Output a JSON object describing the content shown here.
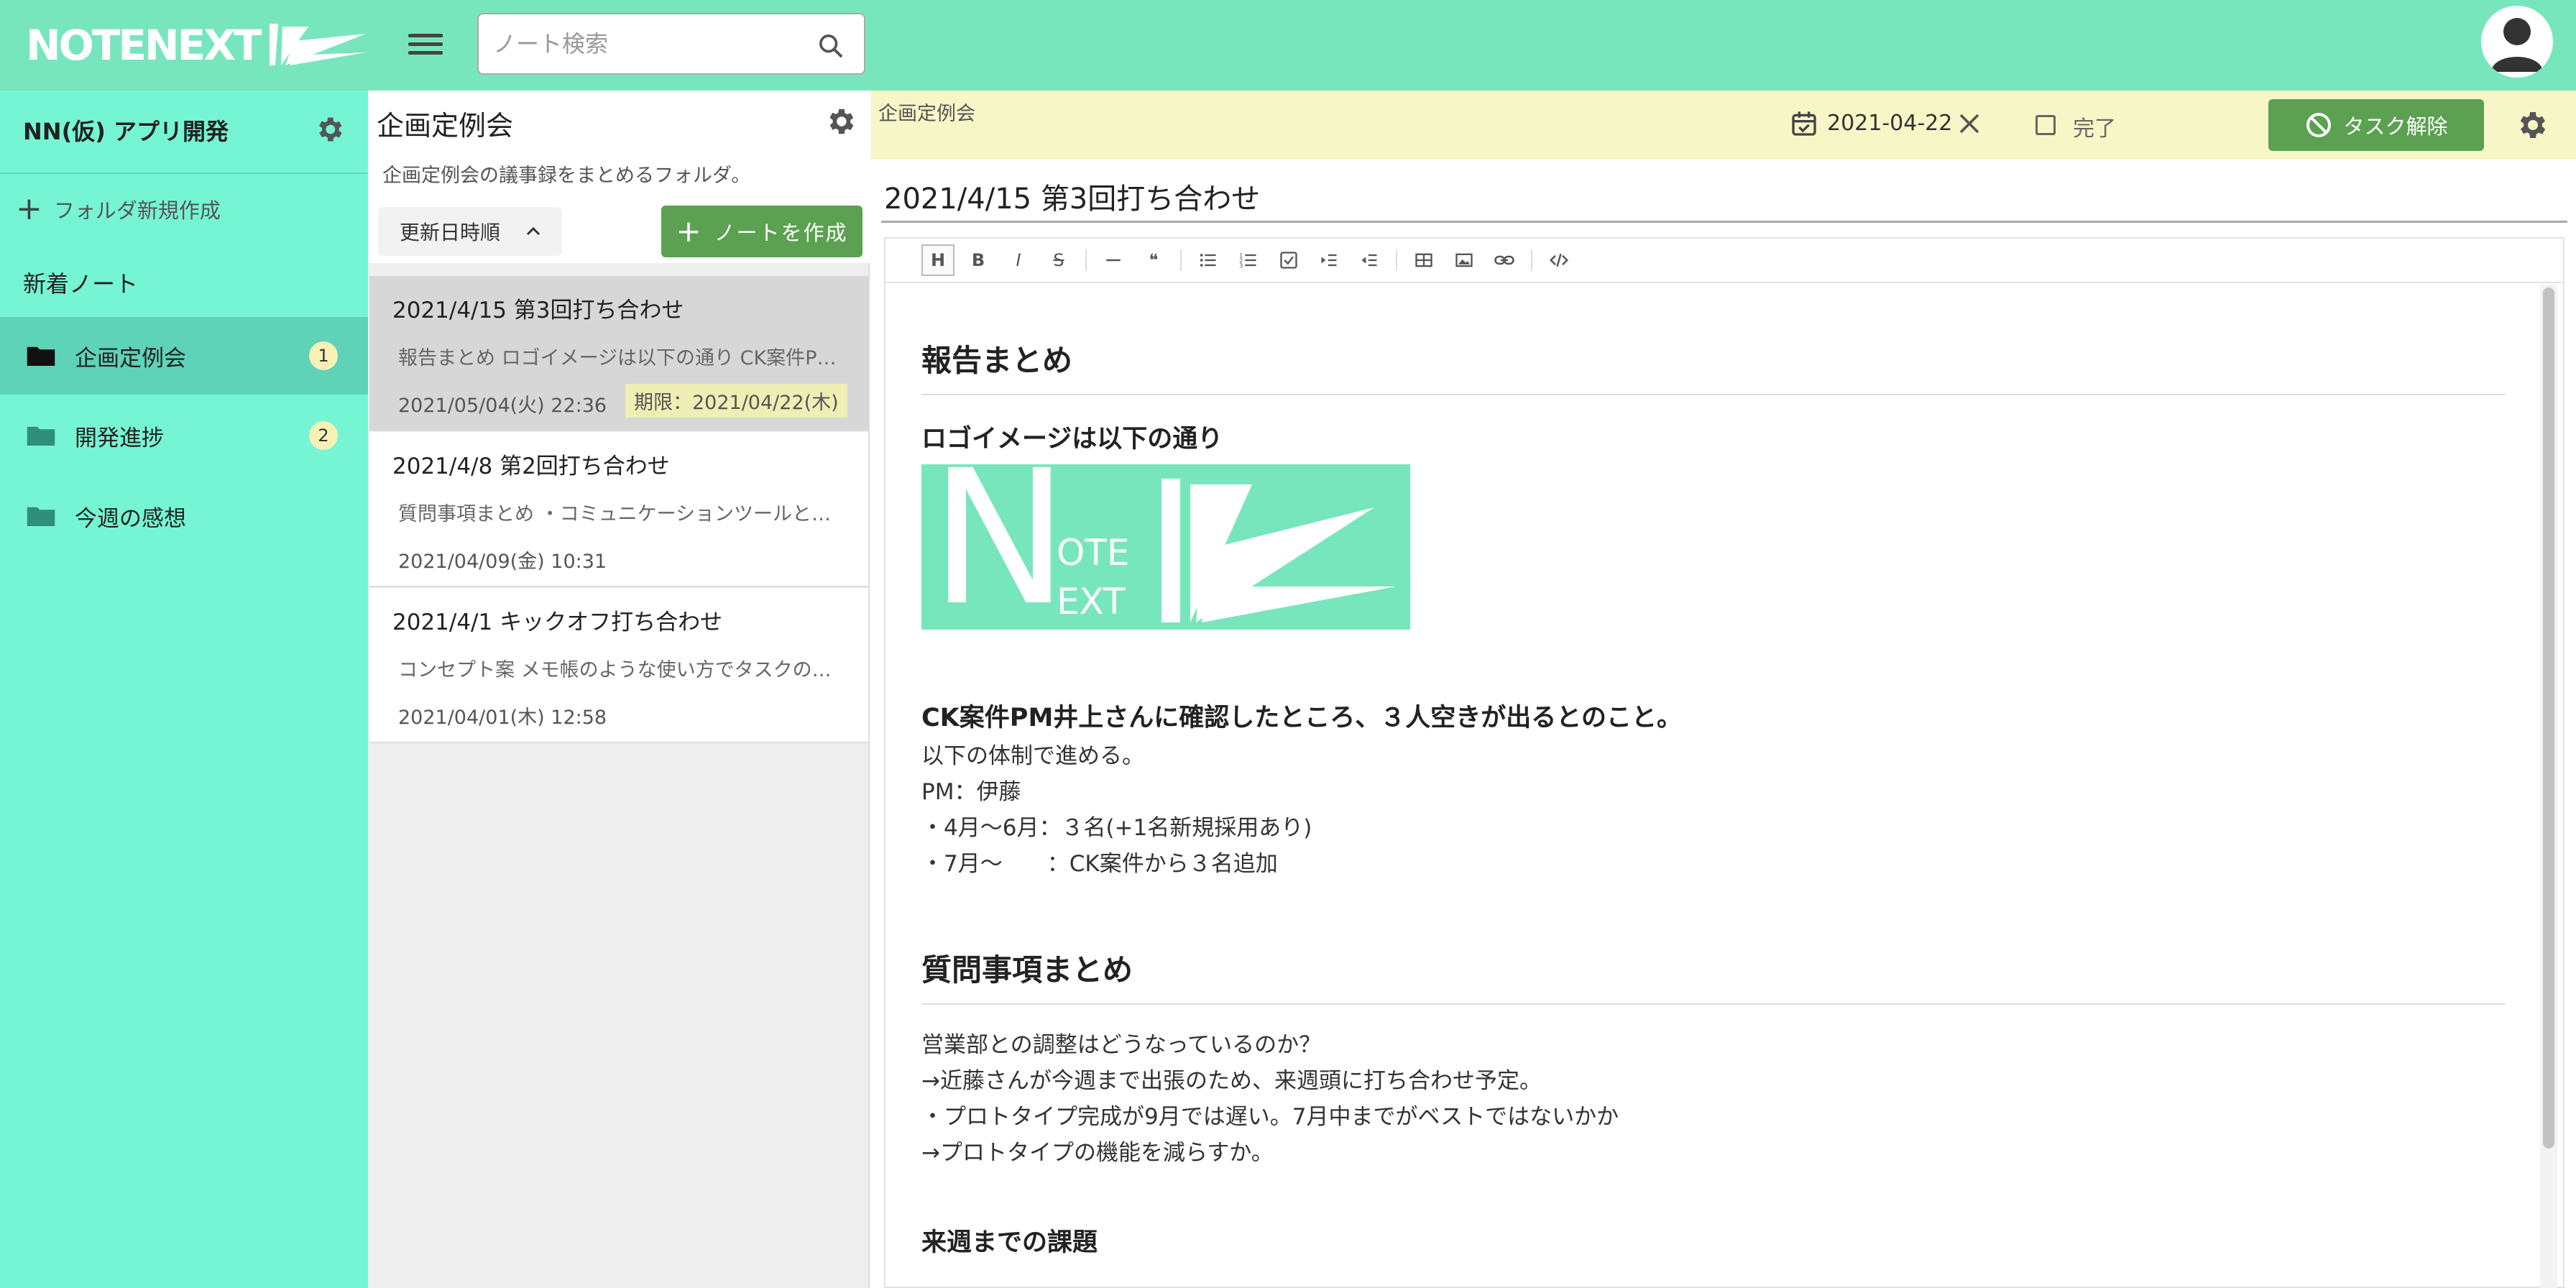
{
  "app": {
    "logo_text": "NOTENEXT",
    "accent": "#78e6bc",
    "sidebar_bg": "#76f5d4",
    "primary_button": "#5ba151"
  },
  "topbar": {
    "search_placeholder": "ノート検索",
    "icons": [
      "menu-icon",
      "search-icon",
      "avatar-icon"
    ]
  },
  "sidebar": {
    "project_title": "NN(仮) アプリ開発",
    "new_folder_label": "フォルダ新規作成",
    "new_notes_label": "新着ノート",
    "folders": [
      {
        "label": "企画定例会",
        "count": "1",
        "active": true
      },
      {
        "label": "開発進捗",
        "count": "2",
        "active": false
      },
      {
        "label": "今週の感想",
        "count": "",
        "active": false
      }
    ]
  },
  "notes_panel": {
    "folder_title": "企画定例会",
    "folder_description": "企画定例会の議事録をまとめるフォルダ。",
    "sort_label": "更新日時順",
    "create_label": "ノートを作成",
    "notes": [
      {
        "title": "2021/4/15 第3回打ち合わせ",
        "preview": "報告まとめ ロゴイメージは以下の通り CK案件PM井上さんに確認したところ",
        "date": "2021/05/04(火) 22:36",
        "deadline": "期限：2021/04/22(木)",
        "active": true
      },
      {
        "title": "2021/4/8 第2回打ち合わせ",
        "preview": "質問事項まとめ ・コミュニケーションツールとしての位置付け",
        "date": "2021/04/09(金) 10:31",
        "deadline": "",
        "active": false
      },
      {
        "title": "2021/4/1 キックオフ打ち合わせ",
        "preview": "コンセプト案 メモ帳のような使い方でタスクの管理ができる",
        "date": "2021/04/01(木) 12:58",
        "deadline": "",
        "active": false
      }
    ]
  },
  "editor": {
    "breadcrumb": "企画定例会",
    "due_date": "2021-04-22",
    "done_label": "完了",
    "task_button_label": "タスク解除",
    "note_title": "2021/4/15 第3回打ち合わせ",
    "toolbar": [
      "heading",
      "bold",
      "italic",
      "strike",
      "hr",
      "quote",
      "ul",
      "ol",
      "task",
      "indent",
      "outdent",
      "table",
      "image",
      "link",
      "code"
    ],
    "toolbar_glyphs": {
      "heading": "H",
      "bold": "B",
      "italic": "I",
      "strike": "S",
      "quote": "❝"
    },
    "content": {
      "h1_report": "報告まとめ",
      "h3_logo": "ロゴイメージは以下の通り",
      "logo_letters": {
        "n": "N",
        "ote": "OTE",
        "ext": "EXT"
      },
      "h3_ck": "CK案件PM井上さんに確認したところ、３人空きが出るとのこと。",
      "p1": "以下の体制で進める。",
      "p2": "PM：伊藤",
      "p3": "・4月〜6月：３名(+1名新規採用あり)",
      "p4": "・7月〜　　：CK案件から３名追加",
      "h1_questions": "質問事項まとめ",
      "q1": "営業部との調整はどうなっているのか？",
      "q2": "→近藤さんが今週まで出張のため、来週頭に打ち合わせ予定。",
      "q3": "・プロトタイプ完成が9月では遅い。7月中までがベストではないかか",
      "q4": "→プロトタイプの機能を減らすか。",
      "h3_next": "来週までの課題"
    }
  }
}
